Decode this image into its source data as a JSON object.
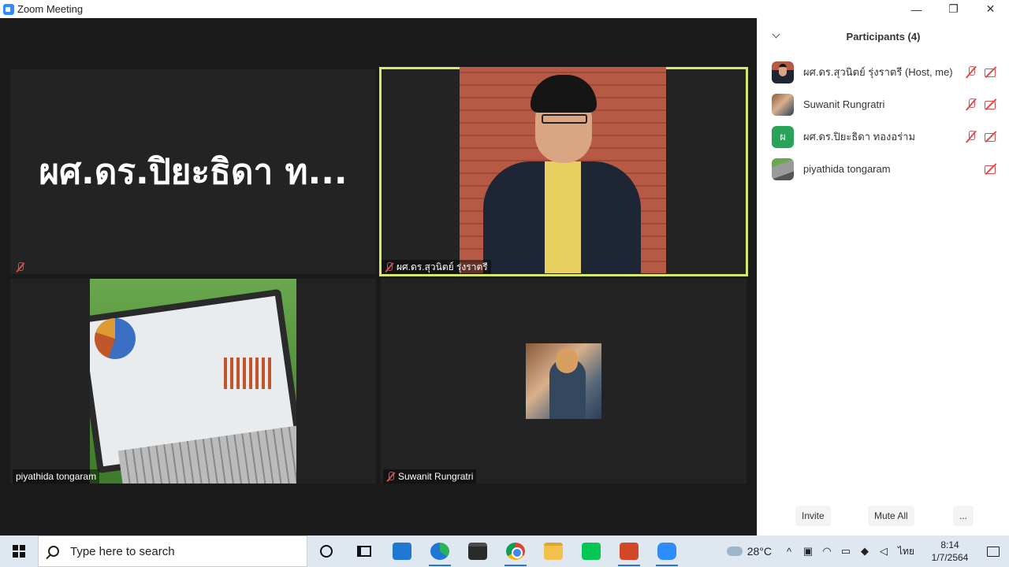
{
  "window": {
    "title": "Zoom Meeting",
    "minimize": "—",
    "maximize": "❐",
    "close": "✕"
  },
  "tiles": [
    {
      "name": "",
      "big_name": "ผศ.ดร.ปิยะธิดา ท...",
      "muted": true,
      "video": false
    },
    {
      "name": "ผศ.ดร.สุวนิตย์ รุ่งราตรี",
      "muted": true,
      "video": true,
      "active": true
    },
    {
      "name": "piyathida tongaram",
      "muted": false,
      "video": true
    },
    {
      "name": "Suwanit Rungratri",
      "muted": true,
      "video": true
    }
  ],
  "panel": {
    "title": "Participants (4)",
    "participants": [
      {
        "name": "ผศ.ดร.สุวนิตย์ รุ่งราตรี (Host, me)",
        "avatar": "photo",
        "mic_muted": true,
        "video_off": true
      },
      {
        "name": "Suwanit Rungratri",
        "avatar": "photo",
        "mic_muted": true,
        "video_off": true
      },
      {
        "name": "ผศ.ดร.ปิยะธิดา ทองอร่าม",
        "avatar_letter": "ผ",
        "mic_muted": true,
        "video_off": true
      },
      {
        "name": "piyathida tongaram",
        "avatar": "photo",
        "mic_muted": false,
        "video_off": true
      }
    ],
    "invite_label": "Invite",
    "mute_all_label": "Mute All",
    "more_label": "..."
  },
  "taskbar": {
    "search_placeholder": "Type here to search",
    "temperature": "28°C",
    "language": "ไทย",
    "time": "8:14",
    "date": "1/7/2564",
    "apps": [
      "cortana-icon",
      "task-view-icon",
      "mail-icon",
      "edge-icon",
      "store-icon",
      "chrome-icon",
      "file-explorer-icon",
      "line-icon",
      "powerpoint-icon",
      "zoom-icon"
    ]
  },
  "colors": {
    "active_speaker": "#d5e86a",
    "muted_red": "#e04c4c",
    "zoom_blue": "#2d8cff"
  }
}
